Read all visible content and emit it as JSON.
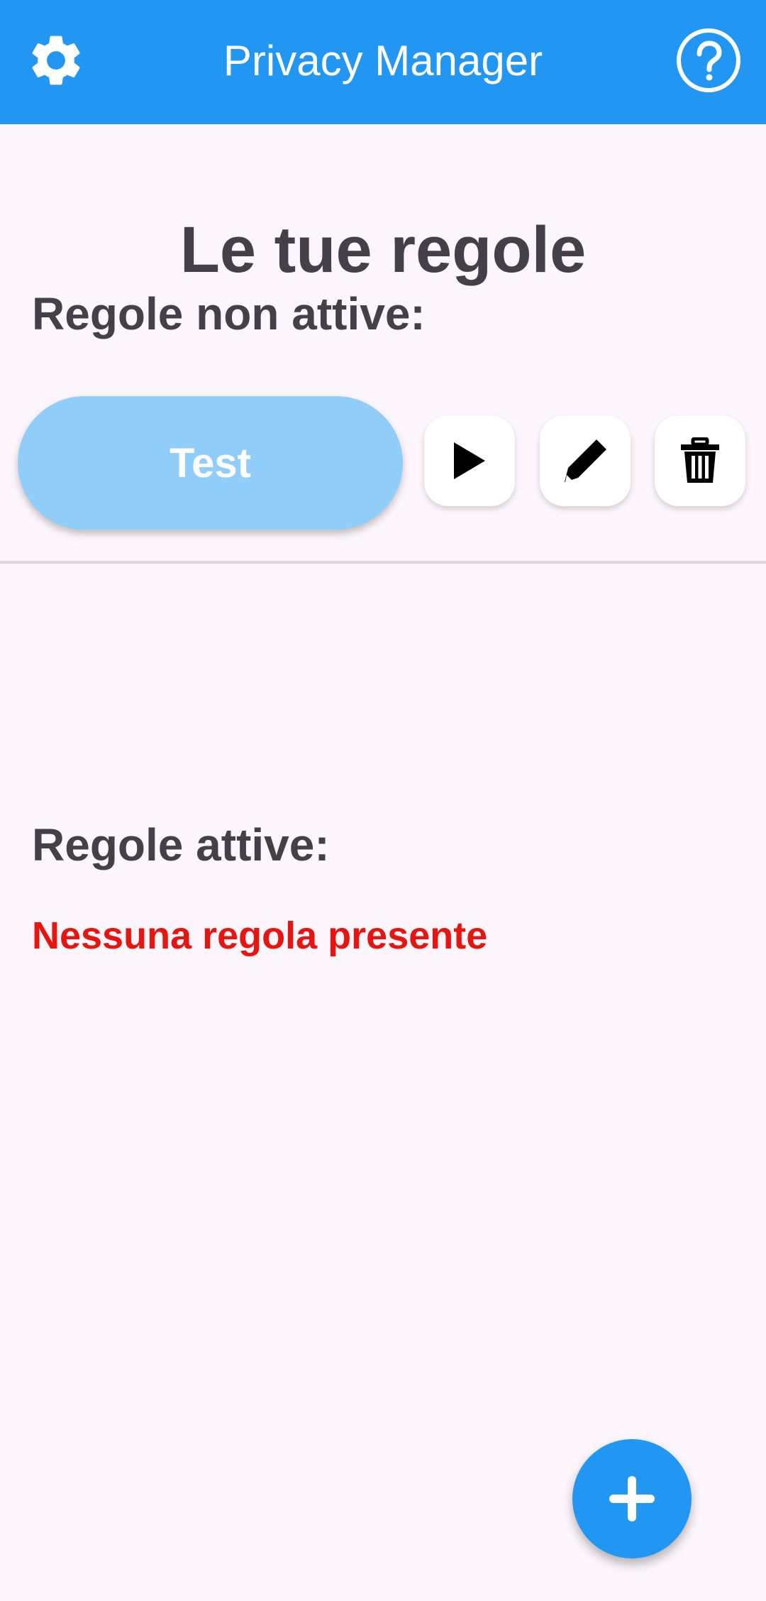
{
  "app_bar": {
    "title": "Privacy Manager",
    "settings_icon": "gear-icon",
    "help_icon": "help-icon",
    "background": "#2196f3"
  },
  "main": {
    "page_title": "Le tue regole",
    "inactive_section": {
      "heading": "Regole non attive:",
      "rules": [
        {
          "name": "Test",
          "actions": [
            "play-icon",
            "pencil-icon",
            "trash-icon"
          ]
        }
      ]
    },
    "active_section": {
      "heading": "Regole attive:",
      "empty_message": "Nessuna regola presente"
    }
  },
  "fab": {
    "icon": "plus-icon"
  },
  "colors": {
    "accent": "#2196f3",
    "pill": "#90cdf8",
    "heading_text": "#43404a",
    "error_text": "#e8140f",
    "background": "#fcf5fb"
  }
}
